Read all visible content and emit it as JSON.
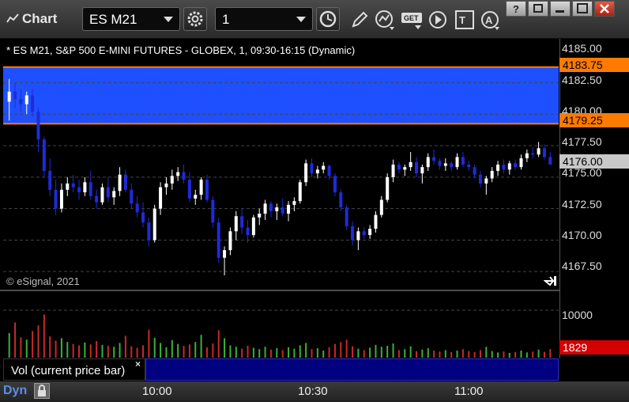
{
  "window": {
    "title": "Chart"
  },
  "toolbar": {
    "symbol": "ES M21",
    "interval": "1"
  },
  "chart": {
    "title": "* ES M21, S&P 500 E-MINI FUTURES - GLOBEX, 1, 09:30-16:15 (Dynamic)",
    "copyright": "© eSignal, 2021",
    "price_axis": [
      "4185.00",
      "4182.50",
      "4180.00",
      "4177.50",
      "4175.00",
      "4172.50",
      "4170.00",
      "4167.50"
    ],
    "price_tags": {
      "upper": "4183.75",
      "lower": "4179.25",
      "last": "4176.00"
    },
    "volume_axis": [
      "10000"
    ],
    "volume_tag": "1829",
    "volume_label": "Vol (current price bar)",
    "volume_close": "×",
    "time_axis": [
      "10:00",
      "10:30",
      "11:00"
    ],
    "dyn_label": "Dyn",
    "colors": {
      "zone": "#1e50ff",
      "up": "#ffffff",
      "down": "#1f2bd8",
      "tag_orange": "#ff7a00",
      "tag_red": "#d40000",
      "vol_up": "#3ab03a",
      "vol_down": "#c82828"
    }
  },
  "chart_data": {
    "type": "candlestick",
    "ylim": [
      4166.0,
      4186.0
    ],
    "zone": [
      4179.25,
      4183.75
    ],
    "last_price": 4176.0,
    "bars_ohlc": [
      [
        4181.0,
        4182.8,
        4179.5,
        4181.8
      ],
      [
        4181.8,
        4182.5,
        4180.5,
        4181.2
      ],
      [
        4181.2,
        4182.0,
        4180.2,
        4180.8
      ],
      [
        4180.8,
        4181.8,
        4180.0,
        4181.5
      ],
      [
        4181.5,
        4182.0,
        4179.8,
        4180.2
      ],
      [
        4180.2,
        4180.5,
        4177.0,
        4178.0
      ],
      [
        4178.0,
        4178.2,
        4175.0,
        4175.5
      ],
      [
        4175.5,
        4176.5,
        4173.5,
        4174.0
      ],
      [
        4174.0,
        4174.8,
        4172.0,
        4172.5
      ],
      [
        4172.5,
        4174.5,
        4172.2,
        4174.0
      ],
      [
        4174.0,
        4175.0,
        4173.5,
        4174.5
      ],
      [
        4174.5,
        4175.2,
        4173.8,
        4174.2
      ],
      [
        4174.2,
        4174.8,
        4173.2,
        4173.8
      ],
      [
        4173.8,
        4175.0,
        4173.5,
        4174.6
      ],
      [
        4174.6,
        4175.5,
        4173.2,
        4173.5
      ],
      [
        4173.5,
        4174.0,
        4172.5,
        4173.0
      ],
      [
        4173.0,
        4174.5,
        4172.8,
        4174.2
      ],
      [
        4174.2,
        4175.0,
        4173.0,
        4173.4
      ],
      [
        4173.4,
        4174.2,
        4172.8,
        4173.9
      ],
      [
        4173.9,
        4175.8,
        4173.5,
        4175.2
      ],
      [
        4175.2,
        4175.6,
        4173.8,
        4174.0
      ],
      [
        4174.0,
        4174.5,
        4172.5,
        4172.9
      ],
      [
        4172.9,
        4173.5,
        4171.8,
        4172.2
      ],
      [
        4172.2,
        4173.0,
        4171.0,
        4171.4
      ],
      [
        4171.4,
        4171.8,
        4169.5,
        4170.0
      ],
      [
        4170.0,
        4172.8,
        4169.8,
        4172.5
      ],
      [
        4172.5,
        4174.6,
        4172.0,
        4174.2
      ],
      [
        4174.2,
        4175.0,
        4173.6,
        4174.5
      ],
      [
        4174.5,
        4175.6,
        4174.0,
        4175.1
      ],
      [
        4175.1,
        4175.8,
        4174.7,
        4175.4
      ],
      [
        4175.4,
        4176.0,
        4174.5,
        4174.8
      ],
      [
        4174.8,
        4175.4,
        4173.0,
        4173.3
      ],
      [
        4173.3,
        4174.0,
        4172.8,
        4173.6
      ],
      [
        4173.6,
        4175.0,
        4173.2,
        4174.8
      ],
      [
        4174.8,
        4175.2,
        4173.0,
        4173.2
      ],
      [
        4173.2,
        4173.5,
        4171.0,
        4171.4
      ],
      [
        4171.4,
        4171.8,
        4168.2,
        4168.6
      ],
      [
        4168.6,
        4169.5,
        4167.2,
        4169.2
      ],
      [
        4169.2,
        4171.0,
        4168.8,
        4170.7
      ],
      [
        4170.7,
        4172.3,
        4170.0,
        4171.9
      ],
      [
        4171.9,
        4172.5,
        4170.5,
        4171.0
      ],
      [
        4171.0,
        4171.6,
        4169.8,
        4170.4
      ],
      [
        4170.4,
        4172.0,
        4170.2,
        4171.8
      ],
      [
        4171.8,
        4172.5,
        4171.2,
        4172.1
      ],
      [
        4172.1,
        4173.2,
        4171.6,
        4172.9
      ],
      [
        4172.9,
        4173.1,
        4171.8,
        4172.3
      ],
      [
        4172.3,
        4172.9,
        4171.6,
        4172.6
      ],
      [
        4172.6,
        4173.3,
        4171.9,
        4172.1
      ],
      [
        4172.1,
        4173.1,
        4171.5,
        4172.8
      ],
      [
        4172.8,
        4173.4,
        4172.3,
        4173.1
      ],
      [
        4173.1,
        4174.8,
        4172.9,
        4174.6
      ],
      [
        4174.6,
        4176.4,
        4174.3,
        4176.1
      ],
      [
        4176.1,
        4176.5,
        4175.0,
        4175.3
      ],
      [
        4175.3,
        4175.9,
        4174.9,
        4175.6
      ],
      [
        4175.6,
        4176.2,
        4175.3,
        4175.9
      ],
      [
        4175.9,
        4176.0,
        4174.8,
        4175.1
      ],
      [
        4175.1,
        4175.3,
        4173.5,
        4173.8
      ],
      [
        4173.8,
        4174.0,
        4172.3,
        4172.6
      ],
      [
        4172.6,
        4172.8,
        4170.8,
        4171.1
      ],
      [
        4171.1,
        4171.5,
        4169.6,
        4170.0
      ],
      [
        4170.0,
        4171.0,
        4169.2,
        4170.7
      ],
      [
        4170.7,
        4171.0,
        4170.1,
        4170.4
      ],
      [
        4170.4,
        4171.2,
        4170.1,
        4170.9
      ],
      [
        4170.9,
        4172.3,
        4170.6,
        4172.0
      ],
      [
        4172.0,
        4173.5,
        4171.8,
        4173.2
      ],
      [
        4173.2,
        4175.3,
        4173.0,
        4175.0
      ],
      [
        4175.0,
        4176.4,
        4174.6,
        4176.0
      ],
      [
        4176.0,
        4176.2,
        4175.3,
        4175.6
      ],
      [
        4175.6,
        4176.0,
        4175.1,
        4175.8
      ],
      [
        4175.8,
        4177.0,
        4175.5,
        4176.2
      ],
      [
        4176.2,
        4176.6,
        4175.0,
        4175.3
      ],
      [
        4175.3,
        4176.0,
        4174.5,
        4175.8
      ],
      [
        4175.8,
        4176.9,
        4175.5,
        4176.6
      ],
      [
        4176.6,
        4177.2,
        4176.0,
        4176.3
      ],
      [
        4176.3,
        4176.5,
        4175.6,
        4175.9
      ],
      [
        4175.9,
        4176.5,
        4175.5,
        4176.1
      ],
      [
        4176.1,
        4176.3,
        4175.5,
        4175.8
      ],
      [
        4175.8,
        4176.9,
        4175.6,
        4176.6
      ],
      [
        4176.6,
        4177.0,
        4175.8,
        4176.0
      ],
      [
        4176.0,
        4176.3,
        4175.5,
        4175.8
      ],
      [
        4175.8,
        4176.0,
        4174.9,
        4175.2
      ],
      [
        4175.2,
        4175.5,
        4174.2,
        4174.5
      ],
      [
        4174.5,
        4175.1,
        4173.6,
        4174.9
      ],
      [
        4174.9,
        4175.8,
        4174.6,
        4175.5
      ],
      [
        4175.5,
        4176.3,
        4175.1,
        4176.0
      ],
      [
        4176.0,
        4176.4,
        4175.3,
        4175.6
      ],
      [
        4175.6,
        4176.3,
        4175.2,
        4176.1
      ],
      [
        4176.1,
        4176.4,
        4175.6,
        4175.8
      ],
      [
        4175.8,
        4176.8,
        4175.6,
        4176.5
      ],
      [
        4176.5,
        4177.2,
        4176.2,
        4176.9
      ],
      [
        4176.9,
        4177.4,
        4176.5,
        4176.8
      ],
      [
        4176.8,
        4177.8,
        4176.6,
        4177.3
      ],
      [
        4177.3,
        4177.6,
        4176.4,
        4176.6
      ],
      [
        4176.6,
        4177.0,
        4176.0,
        4176.0
      ]
    ],
    "volume": [
      5200,
      7400,
      4300,
      3800,
      5600,
      6800,
      9100,
      4500,
      3600,
      4100,
      3300,
      2900,
      2600,
      3200,
      2800,
      3500,
      2700,
      2500,
      2300,
      3100,
      4600,
      2400,
      2100,
      2600,
      5900,
      4200,
      3100,
      2200,
      3700,
      2900,
      2500,
      2800,
      3300,
      4800,
      2200,
      3000,
      5800,
      4100,
      2600,
      2300,
      1900,
      2500,
      2100,
      1800,
      2300,
      1700,
      2000,
      1600,
      2200,
      1900,
      2600,
      3100,
      1800,
      2000,
      1500,
      2200,
      2900,
      3300,
      3800,
      2400,
      1900,
      1600,
      2100,
      2700,
      2300,
      2500,
      3000,
      1600,
      1800,
      2400,
      1400,
      1700,
      2000,
      1500,
      1300,
      1600,
      1200,
      1500,
      1800,
      1400,
      1200,
      1600,
      2300,
      1400,
      1100,
      1300,
      1000,
      1200,
      1500,
      1100,
      1300,
      1700,
      1200,
      1829
    ],
    "volume_ylim": [
      0,
      14000
    ]
  }
}
